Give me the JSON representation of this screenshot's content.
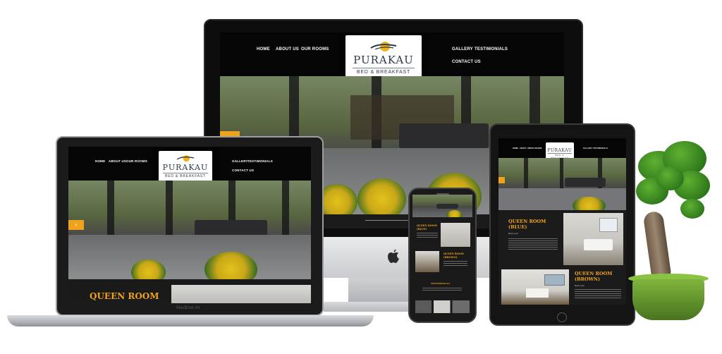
{
  "brand": {
    "name": "PURAKAU",
    "subtitle": "BED & BREAKFAST"
  },
  "nav": {
    "left": [
      "HOME",
      "ABOUT US",
      "OUR ROOMS"
    ],
    "right": [
      "GALLERY",
      "TESTIMONIALS"
    ],
    "contact": "CONTACT US"
  },
  "rooms": {
    "queen": "QUEEN ROOM",
    "queen_blue_1": "QUEEN ROOM",
    "queen_blue_2": "(BLUE)",
    "queen_brown_1": "QUEEN ROOM",
    "queen_brown_2": "(BROWN)",
    "read_more": "Book now!"
  },
  "phone": {
    "testimonials": "TESTIMONIALS"
  },
  "laptop": {
    "label": "MacBook Air"
  },
  "colors": {
    "accent": "#f0a31a",
    "site_background": "#0b0b0b",
    "pot": "#6aa232"
  },
  "icons": {
    "apple": "apple-icon",
    "hero_arrow": "arrow-left-icon"
  }
}
